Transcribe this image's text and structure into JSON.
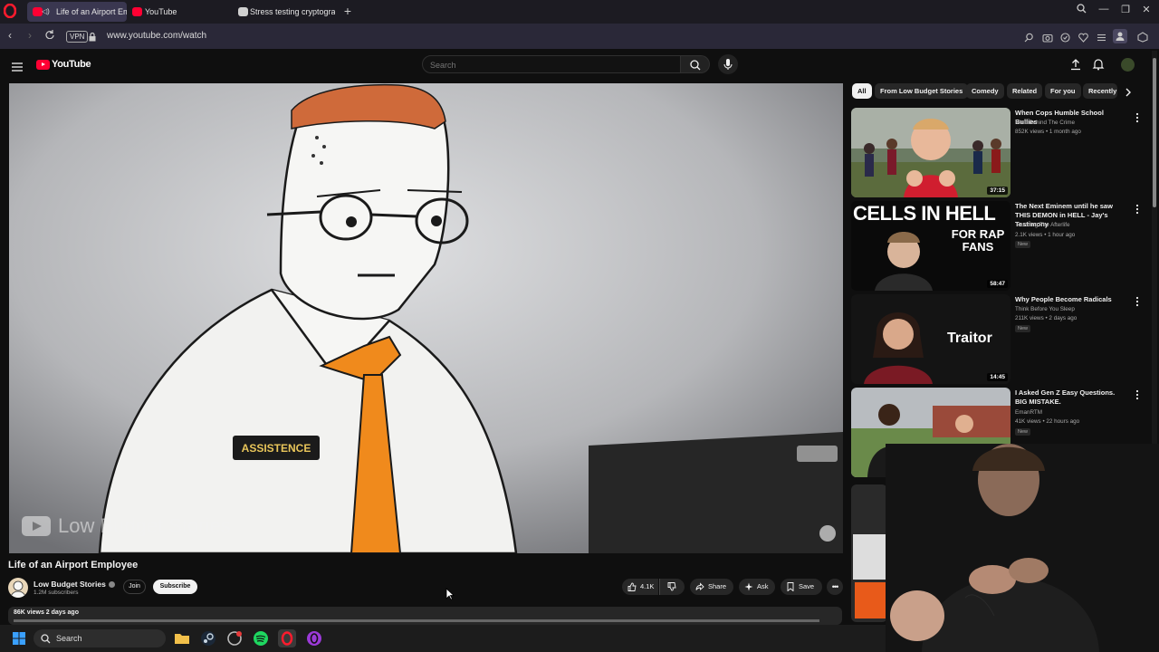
{
  "browser": {
    "tabs": [
      {
        "label": "Life of an Airport Emp",
        "active": true
      },
      {
        "label": "YouTube",
        "active": false
      },
      {
        "label": "Stress testing cryptograph",
        "active": false
      }
    ],
    "vpn_label": "VPN",
    "url": "www.youtube.com/watch"
  },
  "youtube": {
    "logo_text": "YouTube",
    "search_placeholder": "Search"
  },
  "video": {
    "shirt_badge": "ASSISTENCE",
    "watermark": "Low Budget Stories",
    "title": "Life of an Airport Employee",
    "channel": "Low Budget Stories",
    "subscribers": "1.2M subscribers",
    "join_label": "Join",
    "subscribe_label": "Subscribe",
    "likes": "4.1K",
    "share_label": "Share",
    "ask_label": "Ask",
    "save_label": "Save",
    "views_date": "86K views  2 days ago"
  },
  "chips": [
    "All",
    "From Low Budget Stories",
    "Comedy",
    "Related",
    "For you",
    "Recently"
  ],
  "recommendations": [
    {
      "title": "When Cops Humble School Bullies",
      "channel": "Mind Behind The Crime",
      "meta": "852K views • 1 month ago",
      "duration": "37:15",
      "badge": ""
    },
    {
      "title": "The Next Eminem until he saw THIS DEMON in HELL - Jay's Testimony",
      "channel": "Touching The Afterlife",
      "meta": "2.1K views • 1 hour ago",
      "duration": "58:47",
      "badge": "New",
      "thumb_text_1": "CELLS IN HELL",
      "thumb_text_2": "FOR RAP FANS"
    },
    {
      "title": "Why People Become Radicals",
      "channel": "Think Before You Sleep",
      "meta": "211K views • 2 days ago",
      "duration": "14:45",
      "badge": "New",
      "thumb_text_1": "Traitor"
    },
    {
      "title": "I Asked Gen Z Easy Questions. BIG MISTAKE.",
      "channel": "EmanRTM",
      "meta": "41K views • 22 hours ago",
      "duration": "",
      "badge": "New"
    }
  ],
  "taskbar": {
    "search_label": "Search"
  },
  "colors": {
    "youtube_red": "#ff0033",
    "opera_red": "#ff1b2d",
    "background": "#0f0f0f"
  }
}
